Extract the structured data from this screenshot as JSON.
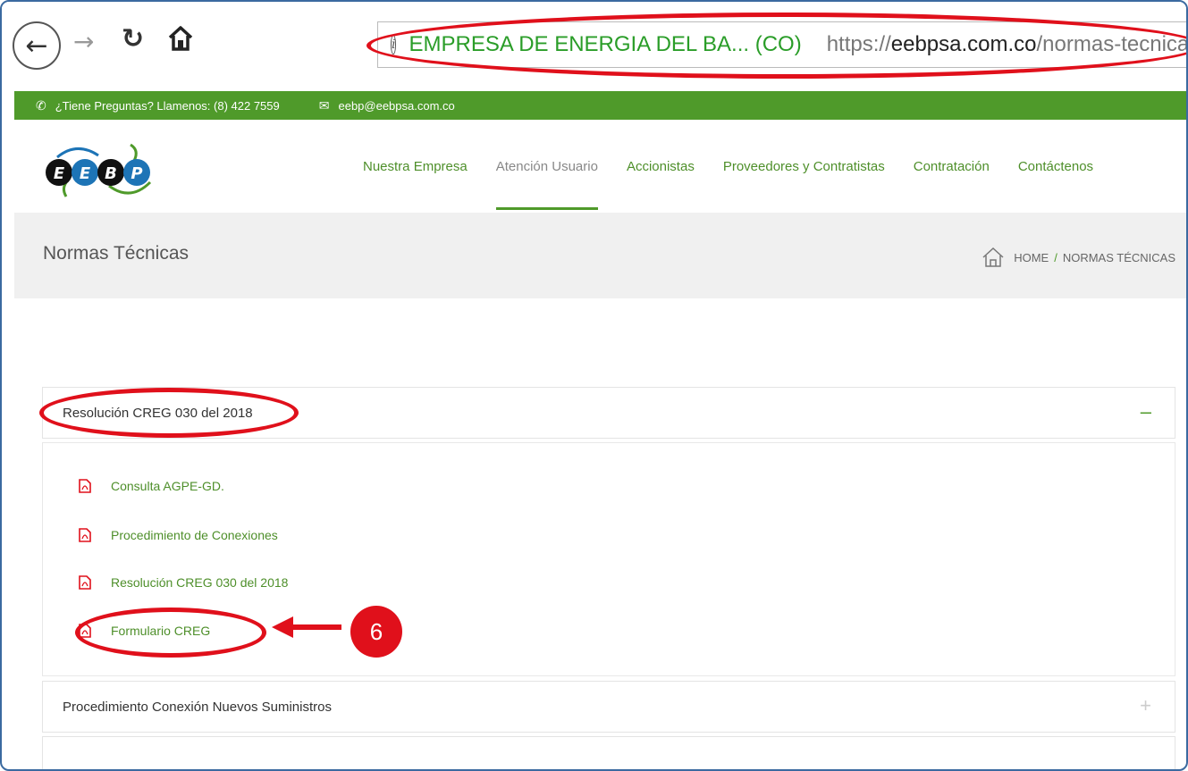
{
  "browser": {
    "back_icon": "back-arrow-icon",
    "forward_icon": "forward-arrow-icon",
    "reload_icon": "reload-icon",
    "home_icon": "home-icon",
    "site_identity": "EMPRESA DE ENERGIA DEL BA...  (CO)",
    "url_scheme": "https://",
    "url_host": "eebpsa.com.co",
    "url_path": "/normas-tecnicas/"
  },
  "topstrip": {
    "phone_text": "¿Tiene Preguntas? Llamenos: (8) 422 7559",
    "email_text": "eebp@eebpsa.com.co",
    "background": "#4f9a2a"
  },
  "logo": {
    "letters": [
      "E",
      "E",
      "B",
      "P"
    ]
  },
  "nav": {
    "items": [
      {
        "label": "Nuestra Empresa",
        "active": false
      },
      {
        "label": "Atención Usuario",
        "active": true
      },
      {
        "label": "Accionistas",
        "active": false
      },
      {
        "label": "Proveedores y Contratistas",
        "active": false
      },
      {
        "label": "Contratación",
        "active": false
      },
      {
        "label": "Contáctenos",
        "active": false
      }
    ]
  },
  "page": {
    "title": "Normas Técnicas",
    "breadcrumb_home": "HOME",
    "breadcrumb_sep": "/",
    "breadcrumb_current": "NORMAS TÉCNICAS"
  },
  "accordion": {
    "sections": [
      {
        "title": "Resolución CREG 030 del 2018",
        "toggle": "–",
        "expanded": true
      },
      {
        "title": "Procedimiento Conexión Nuevos Suministros",
        "toggle": "+",
        "expanded": false
      }
    ],
    "documents": [
      {
        "label": "Consulta AGPE-GD."
      },
      {
        "label": "Procedimiento de Conexiones"
      },
      {
        "label": "Resolución CREG 030 del 2018"
      },
      {
        "label": "Formulario CREG"
      }
    ]
  },
  "annotation": {
    "step_number": "6",
    "color": "#e0101b"
  }
}
